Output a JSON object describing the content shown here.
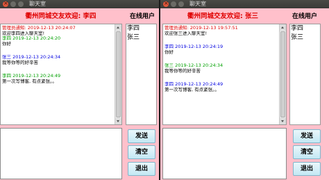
{
  "left_window": {
    "window_title": "聊天室",
    "header_title": "衢州同城交友欢迎: 李四",
    "online_label": "在线用户",
    "messages": [
      {
        "head": "管理员通知:    2019-12-13 20:24:07",
        "text": "欢迎李四进入聊天室!",
        "color": "#e00000"
      },
      {
        "head": "李四  2019-12-13 20:24:20",
        "text": "你好",
        "color": "#00a000"
      },
      {
        "head": "张三  2019-12-13 20:24:34",
        "text": "我等你等的好辛苦",
        "color": "#0000e0"
      },
      {
        "head": "李四  2019-12-13 20:24:49",
        "text": "第一次写博客, 有点紧张。。",
        "color": "#00a000"
      }
    ],
    "online_users": [
      "李四",
      "张三"
    ],
    "buttons": {
      "send": "发送",
      "clear": "清空",
      "exit": "退出"
    }
  },
  "right_window": {
    "window_title": "聊天室",
    "header_title": "衢州同城交友欢迎: 张三",
    "online_label": "在线用户",
    "messages": [
      {
        "head": "管理员通知:    2019-12-13 19:57:51",
        "text": "欢迎张三进入聊天室!",
        "color": "#e00000"
      },
      {
        "head": "李四  2019-12-13 20:24:19",
        "text": "你好",
        "color": "#0000e0"
      },
      {
        "head": "张三  2019-12-13 20:24:34",
        "text": "我等你等的好辛苦",
        "color": "#00a000"
      },
      {
        "head": "李四  2019-12-13 20:24:49",
        "text": "第一次写博客, 有点紧张。。",
        "color": "#0000e0"
      }
    ],
    "online_users": [
      "李四",
      "张三"
    ],
    "buttons": {
      "send": "发送",
      "clear": "清空",
      "exit": "退出"
    }
  },
  "colors": {
    "window_bg": "#ffc0cb",
    "header_red": "#e00000",
    "own_message_green": "#00a000",
    "other_message_blue": "#0000e0",
    "button_bg": "#c3e8f4"
  }
}
